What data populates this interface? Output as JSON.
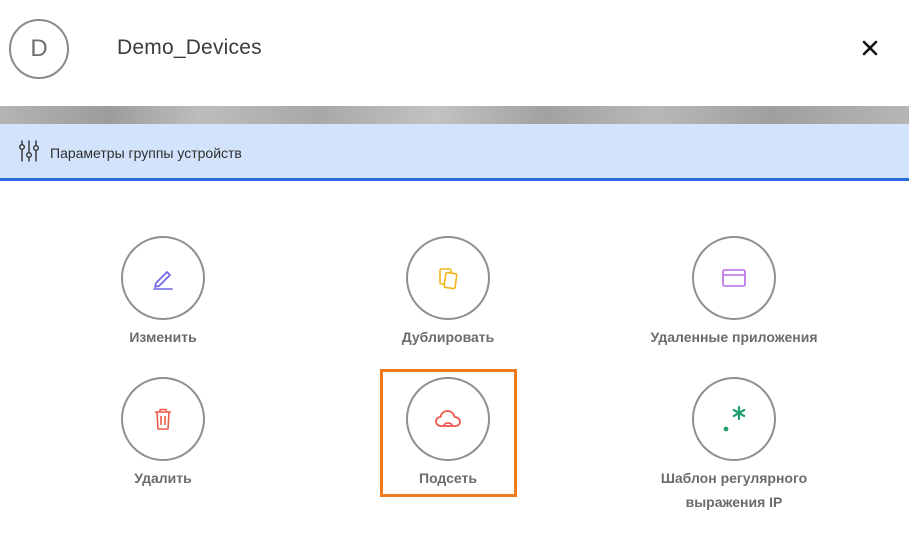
{
  "header": {
    "avatar_letter": "D",
    "title": "Demo_Devices",
    "close_glyph": "✕"
  },
  "section": {
    "icon": "sliders-icon",
    "label": "Параметры группы устройств",
    "accent_color": "#2b6be0",
    "background_color": "#d4e3fc"
  },
  "actions": [
    {
      "label": "Изменить",
      "icon": "pencil-icon",
      "color": "#6b63e8"
    },
    {
      "label": "Дублировать",
      "icon": "duplicate-icon",
      "color": "#f2b51c"
    },
    {
      "label": "Удаленные приложения",
      "icon": "window-icon",
      "color": "#b66be3"
    },
    {
      "label": "Удалить",
      "icon": "trash-icon",
      "color": "#ef5a4b"
    },
    {
      "label": "Подсеть",
      "icon": "cloud-icon",
      "color": "#ef5a4b"
    },
    {
      "label_line1": "Шаблон регулярного",
      "label_line2": "выражения IP",
      "icon": "regex-icon",
      "color": "#22a06b"
    }
  ],
  "highlight_color": "#f07b1d"
}
